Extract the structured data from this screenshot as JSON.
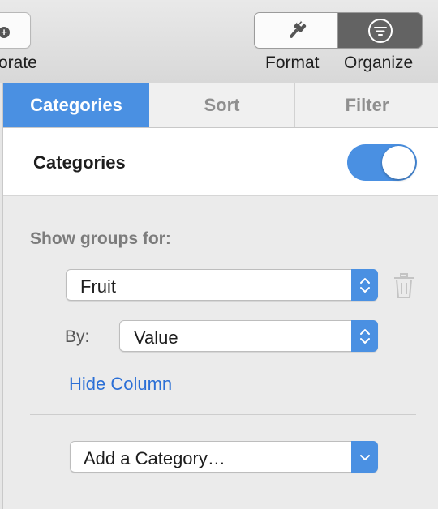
{
  "toolbar": {
    "collaborate_label": "orate",
    "format_label": "Format",
    "organize_label": "Organize"
  },
  "tabs": [
    {
      "label": "Categories",
      "active": true
    },
    {
      "label": "Sort",
      "active": false
    },
    {
      "label": "Filter",
      "active": false
    }
  ],
  "categories": {
    "title": "Categories",
    "enabled": true,
    "show_groups_label": "Show groups for:",
    "group_column": "Fruit",
    "by_label": "By:",
    "by_value": "Value",
    "hide_column_link": "Hide Column",
    "add_category_placeholder": "Add a Category…"
  },
  "colors": {
    "accent": "#4a90e2",
    "link": "#2b6fd6",
    "selected_segment": "#636363"
  }
}
